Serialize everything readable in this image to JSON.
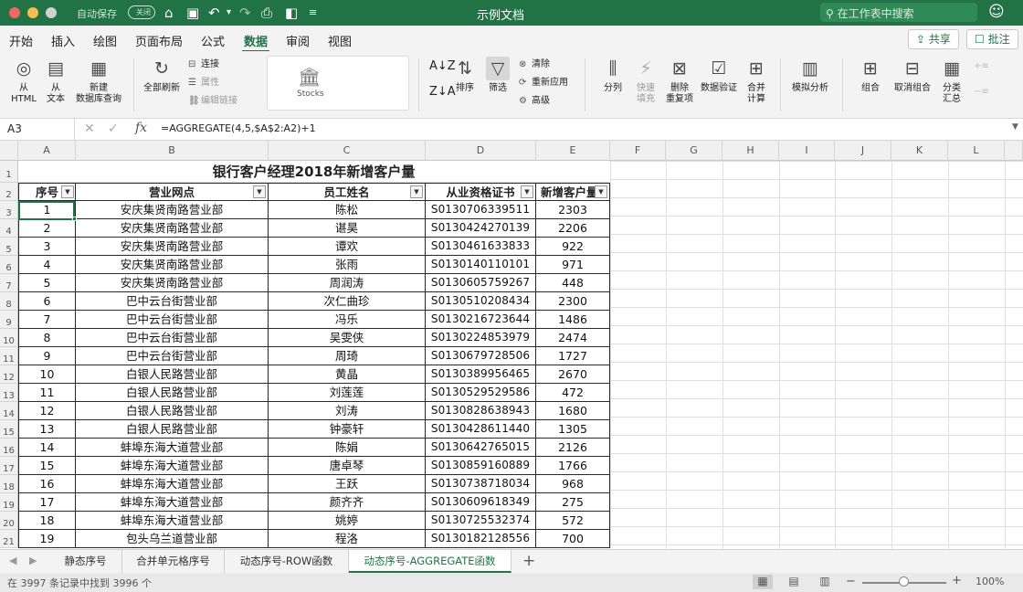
{
  "window": {
    "title": "示例文档",
    "autosave_label": "自动保存",
    "autosave_toggle": "关闭",
    "search_placeholder": "在工作表中搜索",
    "colors": {
      "accent": "#217346"
    }
  },
  "ribbon_tabs": [
    "开始",
    "插入",
    "绘图",
    "页面布局",
    "公式",
    "数据",
    "审阅",
    "视图"
  ],
  "active_tab": "数据",
  "share_label": "共享",
  "comment_label": "批注",
  "ribbon": {
    "from_html": "从\nHTML",
    "from_text": "从\n文本",
    "new_query": "新建\n数据库查询",
    "refresh_all": "全部刷新",
    "connections": "连接",
    "properties": "属性",
    "edit_links": "编辑链接",
    "stocks": "Stocks",
    "sort": "排序",
    "filter": "筛选",
    "clear": "清除",
    "reapply": "重新应用",
    "advanced": "高级",
    "text_to_columns": "分列",
    "flash_fill": "快速\n填充",
    "remove_duplicates": "删除\n重复项",
    "data_validation": "数据验证",
    "consolidate": "合并\n计算",
    "what_if": "模拟分析",
    "group": "组合",
    "ungroup": "取消组合",
    "subtotal": "分类\n汇总"
  },
  "formula_bar": {
    "name_box": "A3",
    "fx": "fx",
    "formula": "=AGGREGATE(4,5,$A$2:A2)+1"
  },
  "columns": [
    "A",
    "B",
    "C",
    "D",
    "E",
    "F",
    "G",
    "H",
    "I",
    "J",
    "K",
    "L"
  ],
  "row_numbers": [
    "1",
    "2",
    "3",
    "4",
    "5",
    "6",
    "7",
    "8",
    "9",
    "10",
    "11",
    "12",
    "13",
    "14",
    "15",
    "16",
    "17",
    "18",
    "19",
    "20",
    "21"
  ],
  "table": {
    "title": "银行客户经理2018年新增客户量",
    "headers": [
      "序号",
      "营业网点",
      "员工姓名",
      "从业资格证书",
      "新增客户量"
    ],
    "rows": [
      [
        "1",
        "安庆集贤南路营业部",
        "陈松",
        "S0130706339511",
        "2303"
      ],
      [
        "2",
        "安庆集贤南路营业部",
        "谌昊",
        "S0130424270139",
        "2206"
      ],
      [
        "3",
        "安庆集贤南路营业部",
        "谭欢",
        "S0130461633833",
        "922"
      ],
      [
        "4",
        "安庆集贤南路营业部",
        "张雨",
        "S0130140110101",
        "971"
      ],
      [
        "5",
        "安庆集贤南路营业部",
        "周润涛",
        "S0130605759267",
        "448"
      ],
      [
        "6",
        "巴中云台街营业部",
        "次仁曲珍",
        "S0130510208434",
        "2300"
      ],
      [
        "7",
        "巴中云台街营业部",
        "冯乐",
        "S0130216723644",
        "1486"
      ],
      [
        "8",
        "巴中云台街营业部",
        "吴雯侠",
        "S0130224853979",
        "2474"
      ],
      [
        "9",
        "巴中云台街营业部",
        "周琦",
        "S0130679728506",
        "1727"
      ],
      [
        "10",
        "白银人民路营业部",
        "黄晶",
        "S0130389956465",
        "2670"
      ],
      [
        "11",
        "白银人民路营业部",
        "刘莲莲",
        "S0130529529586",
        "472"
      ],
      [
        "12",
        "白银人民路营业部",
        "刘涛",
        "S0130828638943",
        "1680"
      ],
      [
        "13",
        "白银人民路营业部",
        "钟豪轩",
        "S0130428611440",
        "1305"
      ],
      [
        "14",
        "蚌埠东海大道营业部",
        "陈娟",
        "S0130642765015",
        "2126"
      ],
      [
        "15",
        "蚌埠东海大道营业部",
        "唐卓琴",
        "S0130859160889",
        "1766"
      ],
      [
        "16",
        "蚌埠东海大道营业部",
        "王跃",
        "S0130738718034",
        "968"
      ],
      [
        "17",
        "蚌埠东海大道营业部",
        "颜齐齐",
        "S0130609618349",
        "275"
      ],
      [
        "18",
        "蚌埠东海大道营业部",
        "姚婷",
        "S0130725532374",
        "572"
      ],
      [
        "19",
        "包头乌兰道营业部",
        "程洛",
        "S0130182128556",
        "700"
      ]
    ]
  },
  "sheet_tabs": [
    "静态序号",
    "合并单元格序号",
    "动态序号-ROW函数",
    "动态序号-AGGREGATE函数"
  ],
  "active_sheet": "动态序号-AGGREGATE函数",
  "add_sheet": "+",
  "status": {
    "message": "在 3997 条记录中找到 3996 个",
    "zoom": "100%",
    "zoom_level": 0.5
  }
}
